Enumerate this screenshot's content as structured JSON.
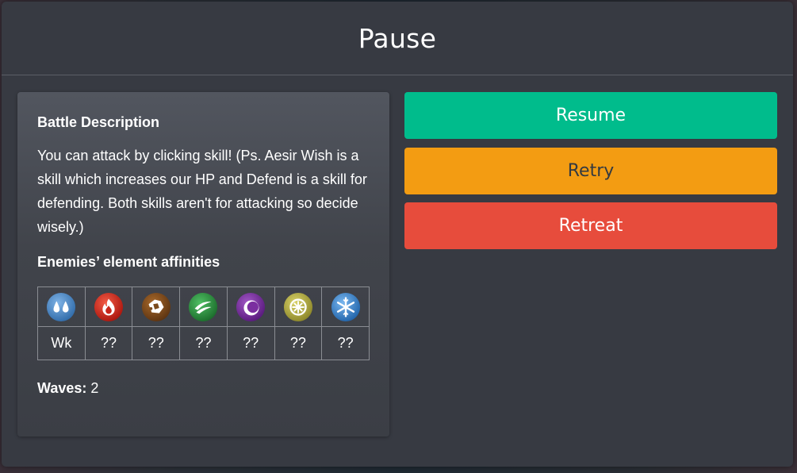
{
  "modal": {
    "title": "Pause"
  },
  "description": {
    "heading": "Battle Description",
    "text": "You can attack by clicking skill! (Ps. Aesir Wish is a skill which increases our HP and Defend is a skill for defending. Both skills aren't for attacking so decide wisely.)",
    "affinities_heading": "Enemies’ element affinities",
    "affinities": [
      {
        "element": "water-icon",
        "color": "#4a86c2",
        "value": "Wk"
      },
      {
        "element": "fire-icon",
        "color": "#c8261b",
        "value": "??"
      },
      {
        "element": "earth-icon",
        "color": "#7a4a1c",
        "value": "??"
      },
      {
        "element": "wind-icon",
        "color": "#2e8b3e",
        "value": "??"
      },
      {
        "element": "dark-icon",
        "color": "#7b2fa0",
        "value": "??"
      },
      {
        "element": "light-icon",
        "color": "#b9b143",
        "value": "??"
      },
      {
        "element": "ice-icon",
        "color": "#3d8ad0",
        "value": "??"
      }
    ],
    "waves_label": "Waves:",
    "waves_value": "2"
  },
  "buttons": {
    "resume": "Resume",
    "retry": "Retry",
    "retreat": "Retreat"
  },
  "colors": {
    "resume": "#00bc8c",
    "retry": "#f39c12",
    "retreat": "#e74c3c",
    "modal_bg": "#373a42"
  }
}
